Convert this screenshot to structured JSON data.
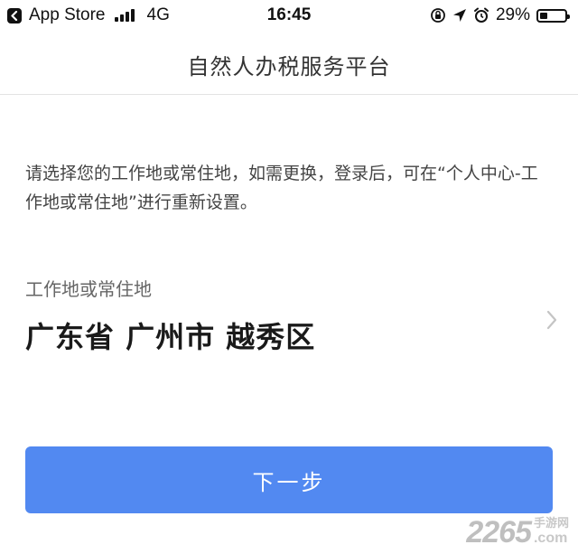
{
  "status_bar": {
    "back_app": "App Store",
    "network": "4G",
    "time": "16:45",
    "battery_percent": "29%",
    "battery_level": 0.29
  },
  "nav": {
    "title": "自然人办税服务平台"
  },
  "notice": {
    "text": "请选择您的工作地或常住地，如需更换，登录后，可在“个人中心-工作地或常住地”进行重新设置。"
  },
  "location": {
    "label": "工作地或常住地",
    "value": "广东省 广州市 越秀区"
  },
  "next_button": {
    "label": "下一步",
    "color": "#5289f1"
  },
  "watermark": {
    "number": "2265",
    "site_cn": "手游网",
    "site_com": ".com"
  }
}
